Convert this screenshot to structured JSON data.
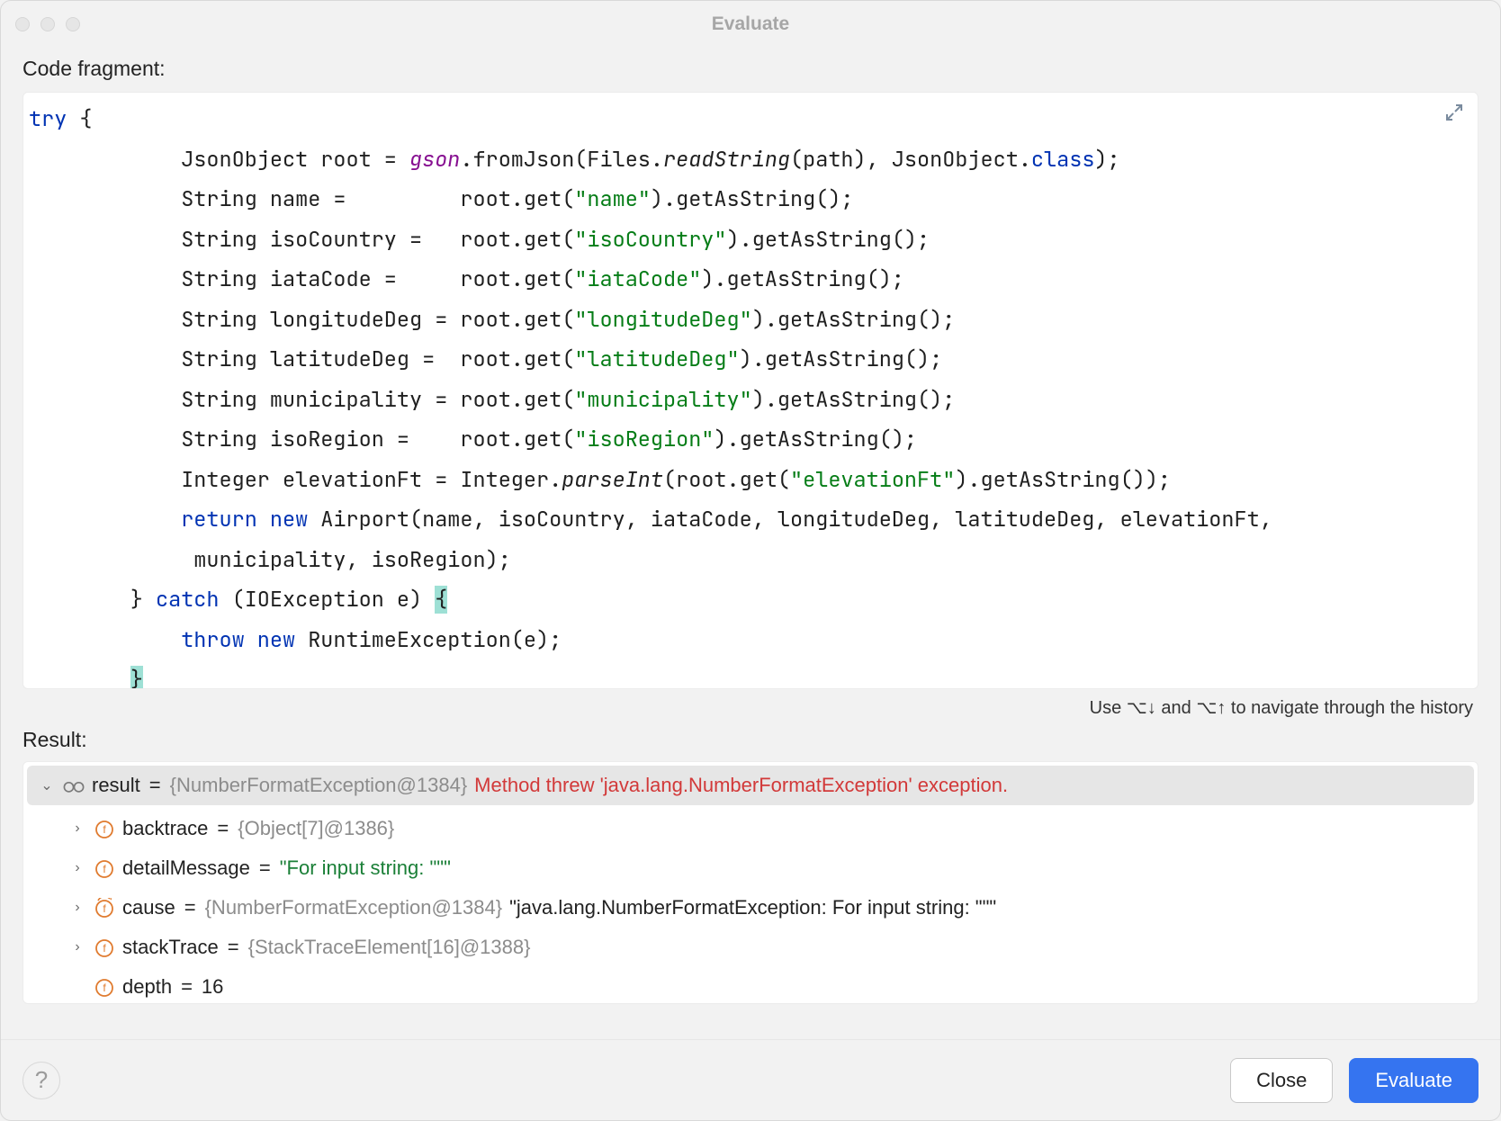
{
  "window": {
    "title": "Evaluate"
  },
  "labels": {
    "code_fragment": "Code fragment:",
    "result": "Result:",
    "history_hint": "Use ⌥↓ and ⌥↑ to navigate through the history"
  },
  "footer": {
    "close": "Close",
    "evaluate": "Evaluate",
    "help_tooltip": "Help"
  },
  "code": {
    "lines": [
      [
        {
          "t": "try",
          "c": "tok-kw"
        },
        {
          "t": " {"
        }
      ],
      [
        {
          "t": "            JsonObject root = "
        },
        {
          "t": "gson",
          "c": "tok-field"
        },
        {
          "t": ".fromJson(Files."
        },
        {
          "t": "readString",
          "c": "tok-static"
        },
        {
          "t": "(path), JsonObject."
        },
        {
          "t": "class",
          "c": "tok-kw"
        },
        {
          "t": ");"
        }
      ],
      [
        {
          "t": "            String name =         root.get("
        },
        {
          "t": "\"name\"",
          "c": "tok-str"
        },
        {
          "t": ").getAsString();"
        }
      ],
      [
        {
          "t": "            String isoCountry =   root.get("
        },
        {
          "t": "\"isoCountry\"",
          "c": "tok-str"
        },
        {
          "t": ").getAsString();"
        }
      ],
      [
        {
          "t": "            String iataCode =     root.get("
        },
        {
          "t": "\"iataCode\"",
          "c": "tok-str"
        },
        {
          "t": ").getAsString();"
        }
      ],
      [
        {
          "t": "            String longitudeDeg = root.get("
        },
        {
          "t": "\"longitudeDeg\"",
          "c": "tok-str"
        },
        {
          "t": ").getAsString();"
        }
      ],
      [
        {
          "t": "            String latitudeDeg =  root.get("
        },
        {
          "t": "\"latitudeDeg\"",
          "c": "tok-str"
        },
        {
          "t": ").getAsString();"
        }
      ],
      [
        {
          "t": "            String municipality = root.get("
        },
        {
          "t": "\"municipality\"",
          "c": "tok-str"
        },
        {
          "t": ").getAsString();"
        }
      ],
      [
        {
          "t": "            String isoRegion =    root.get("
        },
        {
          "t": "\"isoRegion\"",
          "c": "tok-str"
        },
        {
          "t": ").getAsString();"
        }
      ],
      [
        {
          "t": "            Integer elevationFt = Integer."
        },
        {
          "t": "parseInt",
          "c": "tok-static"
        },
        {
          "t": "(root.get("
        },
        {
          "t": "\"elevationFt\"",
          "c": "tok-str"
        },
        {
          "t": ").getAsString());"
        }
      ],
      [
        {
          "t": "            "
        },
        {
          "t": "return new",
          "c": "tok-kw"
        },
        {
          "t": " Airport(name, isoCountry, iataCode, longitudeDeg, latitudeDeg, elevationFt,"
        }
      ],
      [
        {
          "t": "             municipality, isoRegion);"
        }
      ],
      [
        {
          "t": "        } "
        },
        {
          "t": "catch",
          "c": "tok-kw"
        },
        {
          "t": " (IOException e) "
        },
        {
          "t": "{",
          "c": "tok-hl"
        }
      ],
      [
        {
          "t": "            "
        },
        {
          "t": "throw new",
          "c": "tok-kw"
        },
        {
          "t": " RuntimeException(e);"
        }
      ],
      [
        {
          "t": "        "
        },
        {
          "t": "}",
          "c": "tok-hl"
        }
      ]
    ]
  },
  "result_tree": [
    {
      "depth": 0,
      "expanded": true,
      "selected": true,
      "icon": "glasses",
      "name": "result",
      "value_parts": [
        {
          "t": "{NumberFormatException@1384}",
          "c": "val-gray"
        },
        {
          "t": " Method threw 'java.lang.NumberFormatException' exception.",
          "c": "val-red"
        }
      ]
    },
    {
      "depth": 1,
      "expanded": false,
      "icon": "field",
      "name": "backtrace",
      "value_parts": [
        {
          "t": "{Object[7]@1386}",
          "c": "val-gray"
        }
      ]
    },
    {
      "depth": 1,
      "expanded": false,
      "icon": "field",
      "name": "detailMessage",
      "value_parts": [
        {
          "t": "\"For input string: \"\"\"",
          "c": "val-green"
        }
      ]
    },
    {
      "depth": 1,
      "expanded": false,
      "icon": "field-cycle",
      "name": "cause",
      "value_parts": [
        {
          "t": "{NumberFormatException@1384}",
          "c": "val-gray"
        },
        {
          "t": " \"java.lang.NumberFormatException: For input string: \"\"\"",
          "c": "val-black"
        }
      ]
    },
    {
      "depth": 1,
      "expanded": false,
      "icon": "field",
      "name": "stackTrace",
      "value_parts": [
        {
          "t": "{StackTraceElement[16]@1388}",
          "c": "val-gray"
        }
      ]
    },
    {
      "depth": 1,
      "leaf": true,
      "icon": "field",
      "name": "depth",
      "value_parts": [
        {
          "t": "16",
          "c": "val-black"
        }
      ]
    }
  ]
}
